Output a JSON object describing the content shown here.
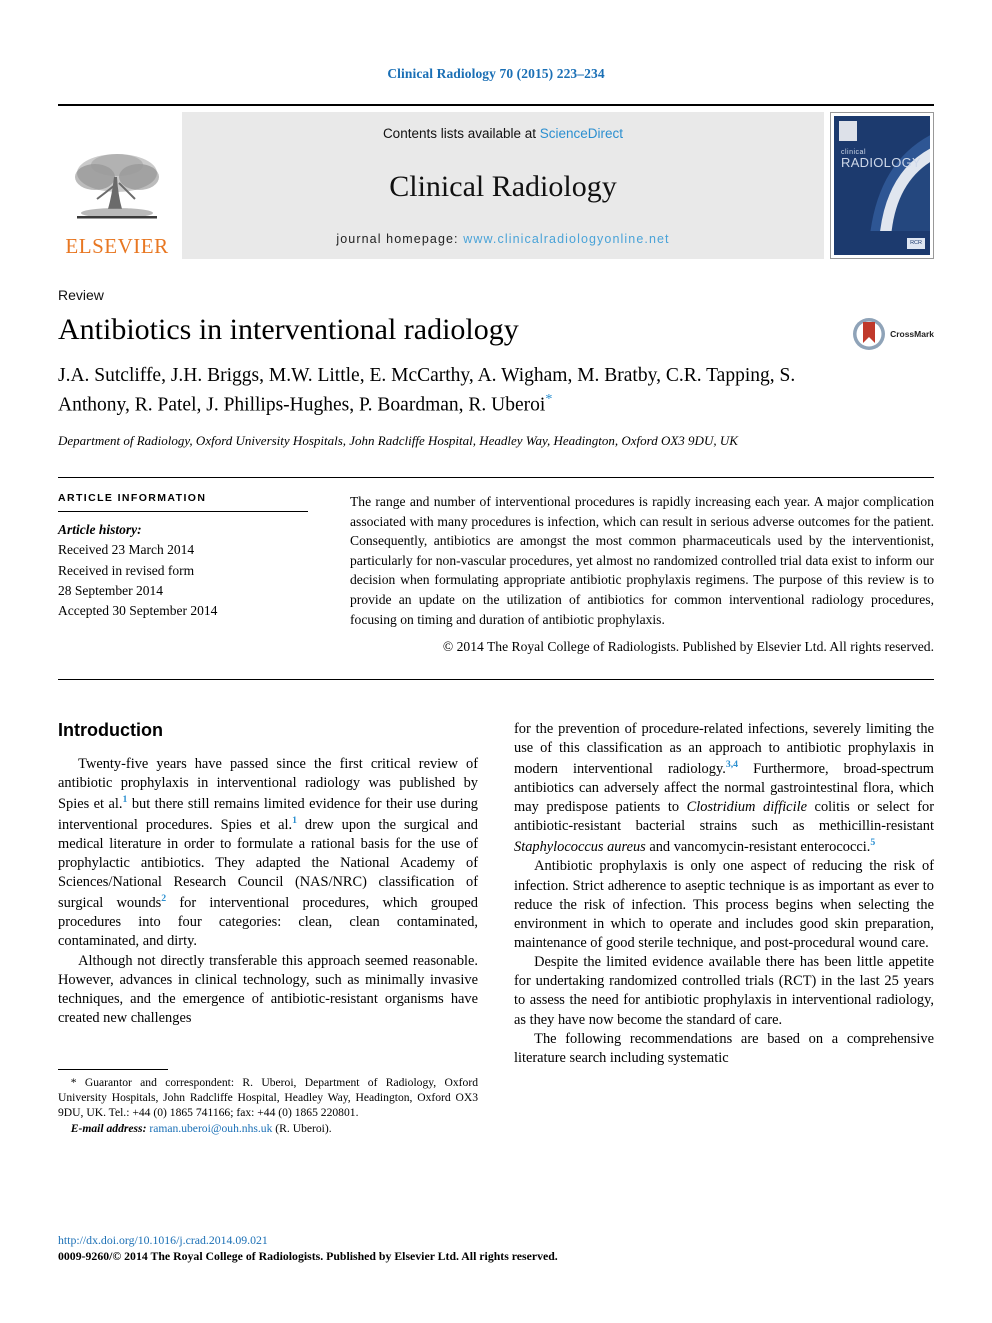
{
  "header": {
    "citation": "Clinical Radiology 70 (2015) 223–234",
    "contents_prefix": "Contents lists available at ",
    "contents_link": "ScienceDirect",
    "journal_name": "Clinical Radiology",
    "homepage_prefix": "journal homepage: ",
    "homepage_url": "www.clinicalradiologyonline.net",
    "publisher_wordmark": "ELSEVIER",
    "cover": {
      "line1": "clinical",
      "line2": "RADIOLOGY",
      "badge": "RCR"
    }
  },
  "article": {
    "kicker": "Review",
    "title": "Antibiotics in interventional radiology",
    "crossmark_label": "CrossMark",
    "authors": "J.A. Sutcliffe, J.H. Briggs, M.W. Little, E. McCarthy, A. Wigham, M. Bratby, C.R. Tapping, S. Anthony, R. Patel, J. Phillips-Hughes, P. Boardman, R. Uberoi",
    "corresponding_marker": "*",
    "affiliation": "Department of Radiology, Oxford University Hospitals, John Radcliffe Hospital, Headley Way, Headington, Oxford OX3 9DU, UK"
  },
  "article_info": {
    "heading": "ARTICLE INFORMATION",
    "history_label": "Article history:",
    "history": [
      "Received 23 March 2014",
      "Received in revised form",
      "28 September 2014",
      "Accepted 30 September 2014"
    ]
  },
  "abstract": {
    "text": "The range and number of interventional procedures is rapidly increasing each year. A major complication associated with many procedures is infection, which can result in serious adverse outcomes for the patient. Consequently, antibiotics are amongst the most common pharmaceuticals used by the interventionist, particularly for non-vascular procedures, yet almost no randomized controlled trial data exist to inform our decision when formulating appropriate antibiotic prophylaxis regimens. The purpose of this review is to provide an update on the utilization of antibiotics for common interventional radiology procedures, focusing on timing and duration of antibiotic prophylaxis.",
    "copyright": "© 2014 The Royal College of Radiologists. Published by Elsevier Ltd. All rights reserved."
  },
  "body": {
    "section_heading": "Introduction",
    "left": {
      "p1_a": "Twenty-five years have passed since the first critical review of antibiotic prophylaxis in interventional radiology was published by Spies et al.",
      "p1_ref1": "1",
      "p1_b": " but there still remains limited evidence for their use during interventional procedures. Spies et al.",
      "p1_ref2": "1",
      "p1_c": " drew upon the surgical and medical literature in order to formulate a rational basis for the use of prophylactic antibiotics. They adapted the National Academy of Sciences/National Research Council (NAS/NRC) classification of surgical wounds",
      "p1_ref3": "2",
      "p1_d": " for interventional procedures, which grouped procedures into four categories: clean, clean contaminated, contaminated, and dirty.",
      "p2": "Although not directly transferable this approach seemed reasonable. However, advances in clinical technology, such as minimally invasive techniques, and the emergence of antibiotic-resistant organisms have created new challenges"
    },
    "right": {
      "p1_a": "for the prevention of procedure-related infections, severely limiting the use of this classification as an approach to antibiotic prophylaxis in modern interventional radiology.",
      "p1_ref1": "3,4",
      "p1_b": " Furthermore, broad-spectrum antibiotics can adversely affect the normal gastrointestinal flora, which may predispose patients to ",
      "p1_italic1": "Clostridium difficile",
      "p1_c": " colitis or select for antibiotic-resistant bacterial strains such as methicillin-resistant ",
      "p1_italic2": "Staphylococcus aureus",
      "p1_d": " and vancomycin-resistant enterococci.",
      "p1_ref2": "5",
      "p2": "Antibiotic prophylaxis is only one aspect of reducing the risk of infection. Strict adherence to aseptic technique is as important as ever to reduce the risk of infection. This process begins when selecting the environment in which to operate and includes good skin preparation, maintenance of good sterile technique, and post-procedural wound care.",
      "p3": "Despite the limited evidence available there has been little appetite for undertaking randomized controlled trials (RCT) in the last 25 years to assess the need for antibiotic prophylaxis in interventional radiology, as they have now become the standard of care.",
      "p4": "The following recommendations are based on a comprehensive literature search including systematic"
    }
  },
  "footnote": {
    "star": "*",
    "text": " Guarantor and correspondent: R. Uberoi, Department of Radiology, Oxford University Hospitals, John Radcliffe Hospital, Headley Way, Headington, Oxford OX3 9DU, UK. Tel.: +44 (0) 1865 741166; fax: +44 (0) 1865 220801.",
    "email_label": "E-mail address:",
    "email": "raman.uberoi@ouh.nhs.uk",
    "email_suffix": " (R. Uberoi)."
  },
  "page_footer": {
    "doi": "http://dx.doi.org/10.1016/j.crad.2014.09.021",
    "issn_copyright": "0009-9260/© 2014 The Royal College of Radiologists. Published by Elsevier Ltd. All rights reserved."
  },
  "colors": {
    "link_blue": "#1a6fb5",
    "ref_blue": "#2b8fd0",
    "elsevier_orange": "#E87722",
    "cover_navy": "#1c3a6e"
  }
}
